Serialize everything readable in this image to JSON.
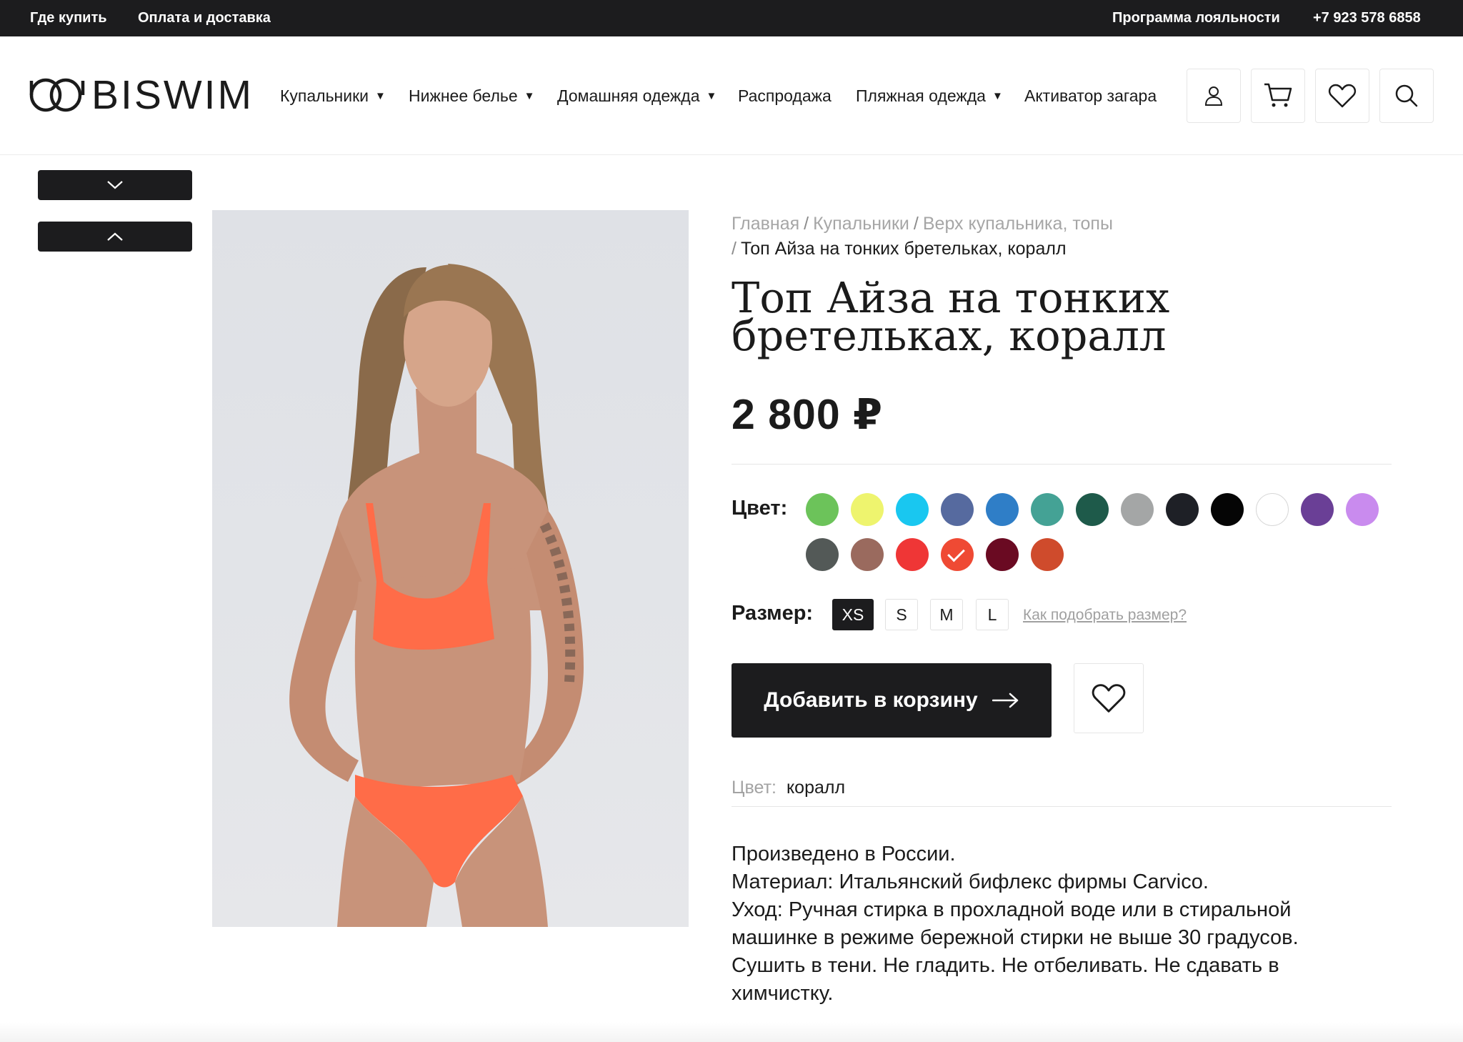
{
  "topbar": {
    "where_to_buy": "Где купить",
    "payment_delivery": "Оплата и доставка",
    "loyalty": "Программа лояльности",
    "phone": "+7 923 578 6858"
  },
  "header": {
    "logo_text": "BISWIM",
    "nav": [
      {
        "label": "Купальники",
        "has_dropdown": true
      },
      {
        "label": "Нижнее белье",
        "has_dropdown": true
      },
      {
        "label": "Домашняя одежда",
        "has_dropdown": true
      },
      {
        "label": "Распродажа",
        "has_dropdown": false
      },
      {
        "label": "Пляжная одежда",
        "has_dropdown": true
      },
      {
        "label": "Активатор загара",
        "has_dropdown": false
      }
    ],
    "caret": "▼",
    "icons": [
      "user-icon",
      "cart-icon",
      "heart-icon",
      "search-icon"
    ]
  },
  "gallery": {
    "down_icon": "chevron-down-icon",
    "up_icon": "chevron-up-icon"
  },
  "breadcrumbs": {
    "items": [
      "Главная",
      "Купальники",
      "Верх купальника, топы"
    ],
    "separator": "/",
    "current": "Топ Айза на тонких бретельках, коралл"
  },
  "product": {
    "title": "Топ Айза на тонких бретельках, коралл",
    "price": "2 800 ₽",
    "color_label": "Цвет:",
    "size_label": "Размер:",
    "colors": [
      {
        "hex": "#6cc35a"
      },
      {
        "hex": "#eef46e"
      },
      {
        "hex": "#19c7f0"
      },
      {
        "hex": "#566a9f"
      },
      {
        "hex": "#2f7ec7"
      },
      {
        "hex": "#44a295"
      },
      {
        "hex": "#1e5a4a"
      },
      {
        "hex": "#a4a6a6"
      },
      {
        "hex": "#1e2026"
      },
      {
        "hex": "#050505"
      },
      {
        "hex": "#ffffff"
      },
      {
        "hex": "#6a3f96"
      },
      {
        "hex": "#c98bee"
      },
      {
        "hex": "#535957"
      },
      {
        "hex": "#9a6a5e"
      },
      {
        "hex": "#ef3636"
      },
      {
        "hex": "#ef4a34",
        "selected": true
      },
      {
        "hex": "#6a0a22"
      },
      {
        "hex": "#cf4b2c"
      }
    ],
    "sizes": [
      {
        "label": "XS",
        "active": true
      },
      {
        "label": "S",
        "active": false
      },
      {
        "label": "M",
        "active": false
      },
      {
        "label": "L",
        "active": false
      }
    ],
    "size_help": "Как подобрать размер?",
    "add_to_cart": "Добавить в корзину",
    "selected_color_key": "Цвет:",
    "selected_color_value": "коралл",
    "description": [
      "Произведено в России.",
      "Материал: Итальянский бифлекс фирмы Carvico.",
      "Уход: Ручная стирка в прохладной воде или в стиральной машинке в режиме бережной стирки не выше 30 градусов. Сушить в тени. Не гладить. Не отбеливать. Не сдавать в химчистку."
    ]
  },
  "colors": {
    "dark": "#1c1c1e",
    "muted_text": "#a6a6a6",
    "border": "#e6e6e6"
  }
}
